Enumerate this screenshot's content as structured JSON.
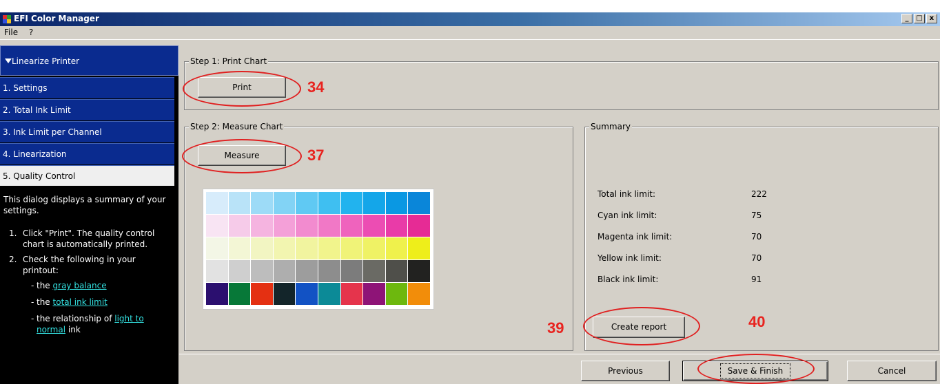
{
  "window": {
    "title": "EFI Color Manager",
    "minimize": "_",
    "maximize": "□",
    "close": "x"
  },
  "menu": [
    {
      "label": "File"
    },
    {
      "label": "?"
    }
  ],
  "sidebar": {
    "header": "Linearize Printer",
    "items": [
      {
        "label": "1. Settings"
      },
      {
        "label": "2. Total Ink Limit"
      },
      {
        "label": "3. Ink Limit per Channel"
      },
      {
        "label": "4. Linearization"
      },
      {
        "label": "5. Quality Control"
      }
    ],
    "help": {
      "intro": "This dialog displays a summary of your settings.",
      "step1_num": "1.",
      "step1": "Click \"Print\". The quality control chart is automatically printed.",
      "step2_num": "2.",
      "step2": "Check the following in your printout:",
      "dash": "-",
      "b1_pre": "the",
      "b1_link": "gray balance",
      "b2_pre": "the",
      "b2_link": "total ink limit",
      "b3_pre": "the relationship of",
      "b3_link": "light to normal",
      "b3_post": "ink"
    }
  },
  "step1": {
    "legend": "Step 1: Print Chart",
    "button": "Print",
    "callout": "34"
  },
  "step2": {
    "legend": "Step 2: Measure Chart",
    "button": "Measure",
    "callout": "37"
  },
  "chart_colors": [
    [
      "#d7ecfb",
      "#b9e3f8",
      "#9ddbf7",
      "#82d3f5",
      "#60c9f3",
      "#3fbff1",
      "#22b3ee",
      "#14a6e9",
      "#0a98e3",
      "#0a86d9"
    ],
    [
      "#f8e4f3",
      "#f6cbe9",
      "#f5b4e0",
      "#f4a0d8",
      "#f28bcf",
      "#f178c6",
      "#ef63bd",
      "#ec4db3",
      "#e93ba8",
      "#e62b95"
    ],
    [
      "#f3f6e6",
      "#f3f6d5",
      "#f2f5c2",
      "#f2f5b0",
      "#f1f49f",
      "#f1f48c",
      "#f0f378",
      "#eff265",
      "#eff14c",
      "#eeee1a"
    ],
    [
      "#e2e2e2",
      "#cfcfcf",
      "#bdbdbd",
      "#aeaeae",
      "#9d9d9d",
      "#8d8d8d",
      "#7c7c7c",
      "#6a6a64",
      "#4f4f4a",
      "#222220"
    ],
    [
      "#2b0f6f",
      "#077838",
      "#e43012",
      "#13252a",
      "#1252c4",
      "#0c8a97",
      "#e5344c",
      "#8e1477",
      "#6db80e",
      "#f28d0a"
    ]
  ],
  "summary": {
    "legend": "Summary",
    "rows": [
      {
        "label": "Total ink limit:",
        "value": "222"
      },
      {
        "label": "Cyan ink limit:",
        "value": "75"
      },
      {
        "label": "Magenta ink limit:",
        "value": "70"
      },
      {
        "label": "Yellow ink limit:",
        "value": "70"
      },
      {
        "label": "Black ink limit:",
        "value": "91"
      }
    ],
    "report_button": "Create report",
    "callout_left": "39",
    "callout_right": "40"
  },
  "footer": {
    "previous": "Previous",
    "save": "Save & Finish",
    "cancel": "Cancel"
  },
  "colors": {
    "accent": "#0a2b8f",
    "callout": "#e8231f",
    "link": "#33e0e0"
  }
}
